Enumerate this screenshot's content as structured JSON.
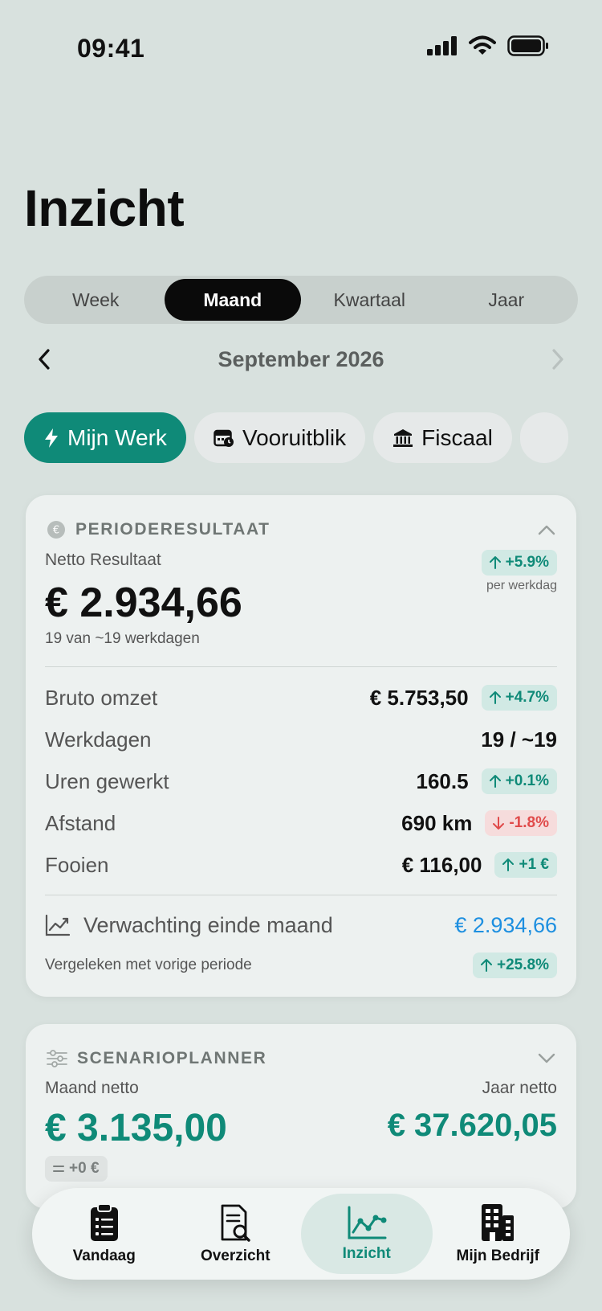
{
  "status": {
    "time": "09:41"
  },
  "page": {
    "title": "Inzicht"
  },
  "segments": [
    {
      "label": "Week",
      "active": false
    },
    {
      "label": "Maand",
      "active": true
    },
    {
      "label": "Kwartaal",
      "active": false
    },
    {
      "label": "Jaar",
      "active": false
    }
  ],
  "period": {
    "label": "September 2026"
  },
  "chips": [
    {
      "label": "Mijn Werk",
      "icon": "bolt-icon",
      "active": true
    },
    {
      "label": "Vooruitblik",
      "icon": "calendar-clock-icon",
      "active": false
    },
    {
      "label": "Fiscaal",
      "icon": "bank-icon",
      "active": false
    }
  ],
  "result_card": {
    "title": "PERIODERESULTAAT",
    "net_label": "Netto Resultaat",
    "net_value": "€ 2.934,66",
    "net_sub": "19 van ~19 werkdagen",
    "net_badge": "+5.9%",
    "net_badge_sub": "per werkdag",
    "stats": [
      {
        "label": "Bruto omzet",
        "value": "€ 5.753,50",
        "badge": "+4.7%",
        "trend": "up"
      },
      {
        "label": "Werkdagen",
        "value": "19 / ~19",
        "badge": "",
        "trend": "none"
      },
      {
        "label": "Uren gewerkt",
        "value": "160.5",
        "badge": "+0.1%",
        "trend": "up"
      },
      {
        "label": "Afstand",
        "value": "690 km",
        "badge": "-1.8%",
        "trend": "down"
      },
      {
        "label": "Fooien",
        "value": "€ 116,00",
        "badge": "+1 €",
        "trend": "up"
      }
    ],
    "forecast_label": "Verwachting einde maand",
    "forecast_value": "€ 2.934,66",
    "compare_label": "Vergeleken met vorige periode",
    "compare_badge": "+25.8%"
  },
  "scenario_card": {
    "title": "SCENARIOPLANNER",
    "month_label": "Maand netto",
    "month_value": "€ 3.135,00",
    "year_label": "Jaar netto",
    "year_value": "€ 37.620,05",
    "delta": "+0 €"
  },
  "tabbar": [
    {
      "label": "Vandaag",
      "icon": "clipboard-icon",
      "active": false
    },
    {
      "label": "Overzicht",
      "icon": "document-search-icon",
      "active": false
    },
    {
      "label": "Inzicht",
      "icon": "chart-line-icon",
      "active": true
    },
    {
      "label": "Mijn Bedrijf",
      "icon": "building-icon",
      "active": false
    }
  ],
  "colors": {
    "accent": "#0f8a78",
    "background": "#d8e1de",
    "card": "#edf1f0",
    "forecast": "#1d8fe0",
    "negative": "#e04a4a"
  }
}
